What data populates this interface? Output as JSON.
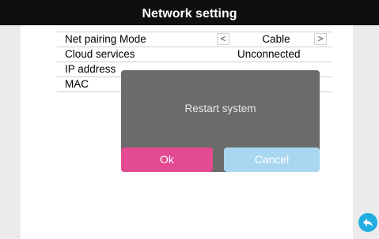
{
  "window": {
    "title": "Network setting"
  },
  "settings": {
    "rows": [
      {
        "label": "Net pairing Mode",
        "value": "Cable"
      },
      {
        "label": "Cloud services",
        "value": "Unconnected"
      },
      {
        "label": "IP address",
        "value": ""
      },
      {
        "label": "MAC",
        "value": ""
      }
    ],
    "prev_symbol": "<",
    "next_symbol": ">"
  },
  "dialog": {
    "message": "Restart system",
    "ok_label": "Ok",
    "cancel_label": "Cancel"
  },
  "icons": {
    "back": "back-arrow-icon"
  },
  "colors": {
    "title_bar": "#0f0f0f",
    "ok_button": "#e44a92",
    "cancel_button": "#a9d6f0",
    "dialog_bg": "#6b6b6b",
    "back_button": "#23aee3"
  }
}
